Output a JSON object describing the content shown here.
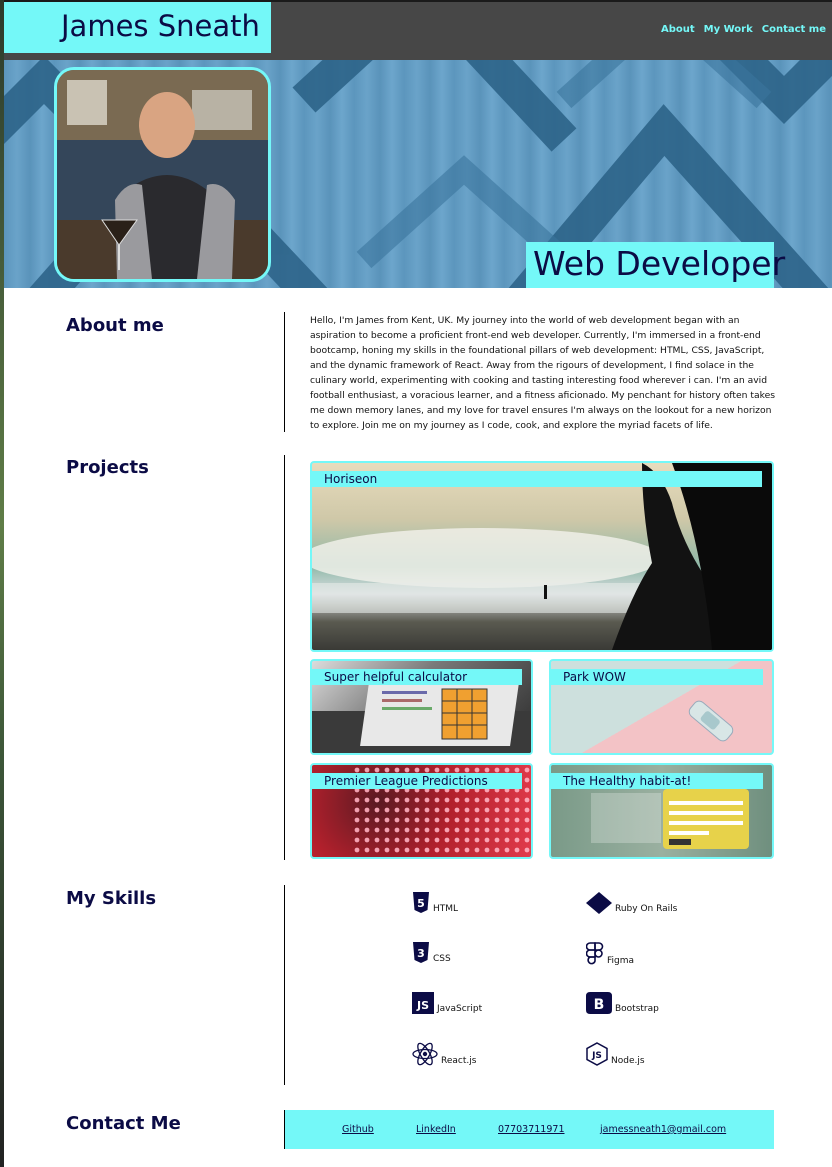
{
  "header": {
    "name": "James Sneath",
    "nav": [
      "About",
      "My Work",
      "Contact me"
    ]
  },
  "hero": {
    "title": "Web Developer"
  },
  "about": {
    "heading": "About me",
    "text": "Hello, I'm James from Kent, UK. My journey into the world of web development began with an aspiration to become a proficient front-end web developer. Currently, I'm immersed in a front-end bootcamp, honing my skills in the foundational pillars of web development: HTML, CSS, JavaScript, and the dynamic framework of React. Away from the rigours of development, I find solace in the culinary world, experimenting with cooking and tasting interesting food wherever i can. I'm an avid football enthusiast, a voracious learner, and a fitness aficionado. My penchant for history often takes me down memory lanes, and my love for travel ensures I'm always on the lookout for a new horizon to explore. Join me on my journey as I code, cook, and explore the myriad facets of life."
  },
  "projects": {
    "heading": "Projects",
    "items": [
      "Horiseon",
      "Super helpful calculator",
      "Park WOW",
      "Premier League Predictions",
      "The Healthy habit-at!"
    ]
  },
  "skills": {
    "heading": "My Skills",
    "items": [
      {
        "label": "HTML",
        "icon": "html5-icon"
      },
      {
        "label": "Ruby On Rails",
        "icon": "ruby-diamond-icon"
      },
      {
        "label": "CSS",
        "icon": "css3-icon"
      },
      {
        "label": "Figma",
        "icon": "figma-icon"
      },
      {
        "label": "JavaScript",
        "icon": "javascript-icon"
      },
      {
        "label": "Bootstrap",
        "icon": "bootstrap-icon"
      },
      {
        "label": "React.js",
        "icon": "react-icon"
      },
      {
        "label": "Node.js",
        "icon": "nodejs-icon"
      }
    ]
  },
  "contact": {
    "heading": "Contact Me",
    "links": [
      "Github",
      "LinkedIn",
      "07703711971",
      "jamessneath1@gmail.com"
    ]
  },
  "colors": {
    "accent": "#74f8f8",
    "navy": "#0b0b45",
    "header_bg": "#474747"
  }
}
